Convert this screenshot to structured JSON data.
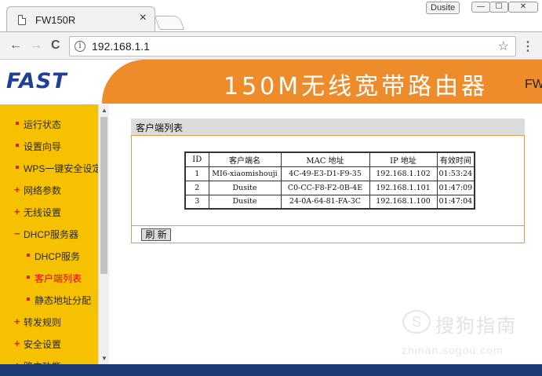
{
  "browser": {
    "tab_title": "FW150R",
    "tab_close": "×",
    "user_badge": "Dusite",
    "window_buttons": {
      "minimize": "—",
      "maximize": "☐",
      "close": "✕"
    },
    "nav": {
      "back": "←",
      "forward": "→",
      "reload": "C"
    },
    "url": "192.168.1.1",
    "info_icon": "i",
    "star_icon": "☆",
    "menu_icon": "⋮"
  },
  "router": {
    "logo": "FAST",
    "product_title": "150M无线宽带路由器",
    "model_fragment": "FW",
    "colors": {
      "header_orange": "#ee8c2b",
      "sidebar_yellow": "#f6c200",
      "active_menu": "#e60000",
      "logo_blue": "#1f3f99"
    }
  },
  "sidebar": {
    "items": [
      {
        "label": "运行状态",
        "marker": "bullet"
      },
      {
        "label": "设置向导",
        "marker": "bullet"
      },
      {
        "label": "WPS一键安全设定",
        "marker": "bullet"
      },
      {
        "label": "网络参数",
        "marker": "plus"
      },
      {
        "label": "无线设置",
        "marker": "plus"
      },
      {
        "label": "DHCP服务器",
        "marker": "minus"
      },
      {
        "label": "DHCP服务",
        "marker": "bullet",
        "sub": true
      },
      {
        "label": "客户端列表",
        "marker": "bullet",
        "sub": true,
        "active": true
      },
      {
        "label": "静态地址分配",
        "marker": "bullet",
        "sub": true
      },
      {
        "label": "转发规则",
        "marker": "plus"
      },
      {
        "label": "安全设置",
        "marker": "plus"
      },
      {
        "label": "路由功能",
        "marker": "plus"
      }
    ]
  },
  "panel": {
    "title": "客户端列表",
    "refresh_label": "刷 新",
    "table": {
      "headers": [
        "ID",
        "客户端名",
        "MAC 地址",
        "IP 地址",
        "有效时间"
      ],
      "rows": [
        [
          "1",
          "MI6-xiaomishouji",
          "4C-49-E3-D1-F9-35",
          "192.168.1.102",
          "01:53:24"
        ],
        [
          "2",
          "Dusite",
          "C0-CC-F8-F2-0B-4E",
          "192.168.1.101",
          "01:47:09"
        ],
        [
          "3",
          "Dusite",
          "24-0A-64-81-FA-3C",
          "192.168.1.100",
          "01:47:04"
        ]
      ]
    }
  },
  "watermark": {
    "symbol": "S",
    "text": "搜狗指南",
    "url": "zhinan.sogou.com"
  }
}
